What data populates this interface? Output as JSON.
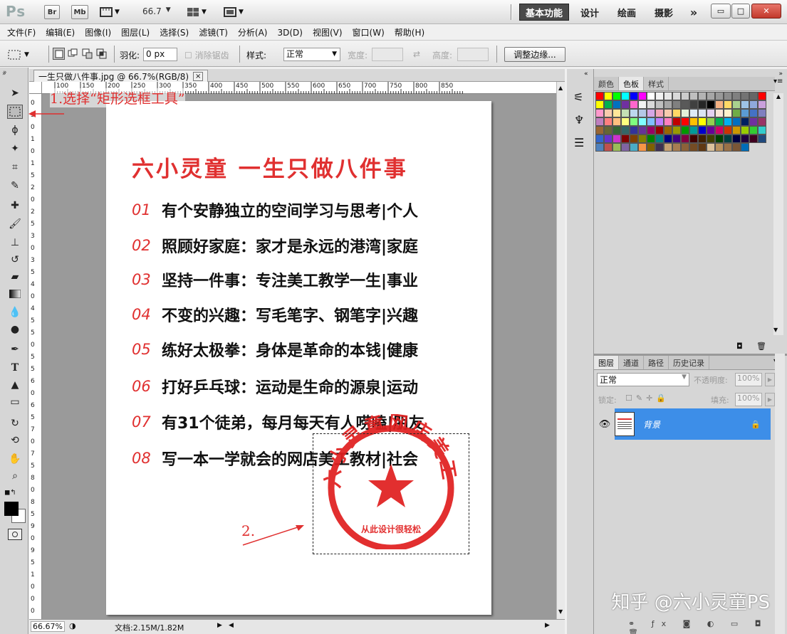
{
  "app": {
    "logo": "Ps",
    "bridge": "Br",
    "minibridge": "Mb",
    "zoom": "66.7",
    "workspaces": [
      "基本功能",
      "设计",
      "绘画",
      "摄影"
    ],
    "more": "»",
    "win_min": "▭",
    "win_max": "□",
    "win_close": "✕"
  },
  "menu": [
    "文件(F)",
    "编辑(E)",
    "图像(I)",
    "图层(L)",
    "选择(S)",
    "滤镜(T)",
    "分析(A)",
    "3D(D)",
    "视图(V)",
    "窗口(W)",
    "帮助(H)"
  ],
  "options": {
    "feather_label": "羽化:",
    "feather_value": "0 px",
    "antialias": "消除锯齿",
    "style_label": "样式:",
    "style_value": "正常",
    "width_label": "宽度:",
    "height_label": "高度:",
    "refine_edge": "调整边缘..."
  },
  "document": {
    "tab_title": "一生只做八件事.jpg @ 66.7%(RGB/8)",
    "tab_close": "×",
    "ruler_h": [
      "100",
      "150",
      "200",
      "250",
      "300",
      "350",
      "400",
      "450",
      "500",
      "550",
      "600",
      "650",
      "700",
      "750",
      "800",
      "850"
    ],
    "ruler_v": [
      "0",
      "5",
      "0",
      "1",
      "0",
      "1",
      "5",
      "2",
      "0",
      "2",
      "5",
      "3",
      "0",
      "3",
      "5",
      "4",
      "0",
      "4",
      "5",
      "5",
      "0",
      "5",
      "5",
      "6",
      "0",
      "6",
      "5",
      "7",
      "0",
      "7",
      "5",
      "8",
      "0",
      "8",
      "5",
      "9",
      "0",
      "9",
      "5",
      "1",
      "0",
      "0",
      "0"
    ],
    "status_zoom": "66.67%",
    "status_doc": "文档:2.15M/1.82M"
  },
  "annotations": {
    "step1": "1.选择“矩形选框工具”",
    "step2": "2."
  },
  "content": {
    "heading": "六小灵童  一生只做八件事",
    "items": [
      {
        "num": "01",
        "text": "有个安静独立的空间学习与思考|个人"
      },
      {
        "num": "02",
        "text": "照顾好家庭：家才是永远的港湾|家庭"
      },
      {
        "num": "03",
        "text": "坚持一件事：专注美工教学一生|事业"
      },
      {
        "num": "04",
        "text": "不变的兴趣：写毛笔字、钢笔字|兴趣"
      },
      {
        "num": "05",
        "text": "练好太极拳：身体是革命的本钱|健康"
      },
      {
        "num": "06",
        "text": "打好乒乓球：运动是生命的源泉|运动"
      },
      {
        "num": "07",
        "text": "有31个徒弟，每月每天有人唠嗑|朋友"
      },
      {
        "num": "08",
        "text": "写一本一学就会的网店美工教材|社会"
      }
    ],
    "stamp_arc": "六小灵童网店美工",
    "stamp_bottom": "从此设计很轻松"
  },
  "panels": {
    "swatch_tabs": [
      "颜色",
      "色板",
      "样式"
    ],
    "layer_tabs": [
      "图层",
      "通道",
      "路径",
      "历史记录"
    ],
    "blend_mode": "正常",
    "opacity_label": "不透明度:",
    "opacity_value": "100%",
    "lock_label": "锁定:",
    "fill_label": "填充:",
    "fill_value": "100%",
    "layer_name": "背景"
  },
  "watermark": "知乎 @六小灵童PS",
  "colors": {
    "accent_red": "#e03030",
    "layer_selected": "#3d8ee8",
    "swatches": [
      "#ff0000",
      "#ffff00",
      "#00ff00",
      "#00ffff",
      "#0000ff",
      "#ff00ff",
      "#ffffff",
      "#f2f2f2",
      "#e6e6e6",
      "#d9d9d9",
      "#cccccc",
      "#bfbfbf",
      "#b3b3b3",
      "#a6a6a6",
      "#999999",
      "#8c8c8c",
      "#808080",
      "#737373",
      "#666666",
      "#ff0000",
      "#ffff00",
      "#00b050",
      "#0070c0",
      "#7030a0",
      "#ff66cc",
      "#f2f2f2",
      "#d9d9d9",
      "#bfbfbf",
      "#a6a6a6",
      "#808080",
      "#595959",
      "#404040",
      "#262626",
      "#000000",
      "#f4b183",
      "#ffd966",
      "#a9d18e",
      "#9dc3e6",
      "#8faadc",
      "#c9a0dc",
      "#ff99cc",
      "#f8cbad",
      "#ffe699",
      "#c5e0b4",
      "#bdd7ee",
      "#b4c7e7",
      "#d5a6e6",
      "#f4a6b8",
      "#f8cbad",
      "#ffd966",
      "#e2f0d9",
      "#deebf7",
      "#dae3f3",
      "#e4d1f0",
      "#fbe5d6",
      "#fff2cc",
      "#70ad47",
      "#5b9bd5",
      "#4472c4",
      "#7f7fbf",
      "#bf7fbf",
      "#ff7f7f",
      "#ffbf7f",
      "#ffff7f",
      "#7fff7f",
      "#7fffff",
      "#7fbfff",
      "#bf7fff",
      "#ff7fbf",
      "#c00000",
      "#ff0000",
      "#ffc000",
      "#ffff00",
      "#92d050",
      "#00b050",
      "#00b0f0",
      "#0070c0",
      "#002060",
      "#7030a0",
      "#993366",
      "#996633",
      "#666633",
      "#336633",
      "#336666",
      "#333399",
      "#663399",
      "#990066",
      "#990000",
      "#996600",
      "#999900",
      "#009900",
      "#009999",
      "#0000cc",
      "#660099",
      "#cc0066",
      "#cc3300",
      "#cc9900",
      "#99cc00",
      "#33cc33",
      "#33cccc",
      "#3366cc",
      "#6633cc",
      "#cc33cc",
      "#800000",
      "#804000",
      "#808000",
      "#008000",
      "#008080",
      "#000080",
      "#400080",
      "#800040",
      "#400000",
      "#402000",
      "#404000",
      "#004000",
      "#004040",
      "#000040",
      "#200040",
      "#400020",
      "#1f497d",
      "#4f81bd",
      "#c0504d",
      "#9bbb59",
      "#8064a2",
      "#4bacc6",
      "#f79646",
      "#7f6000",
      "#3f3151",
      "#c6a173",
      "#a67c52",
      "#8c6239",
      "#754c24",
      "#603913",
      "#dbc39d",
      "#b8925f",
      "#987148",
      "#7a5636",
      "#006db8"
    ]
  }
}
